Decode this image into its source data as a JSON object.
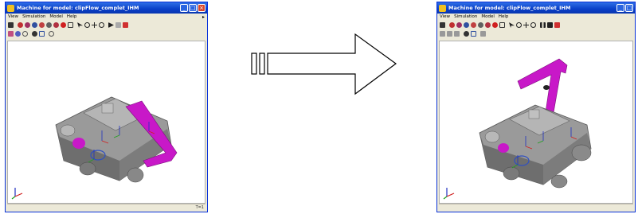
{
  "left_window": {
    "title": "Machine for model: clipFlow_complet_IHM",
    "menus": [
      "View",
      "Simulation",
      "Model",
      "Help"
    ],
    "status_right": "T=1"
  },
  "right_window": {
    "title": "Machine for model: clipFlow_complet_IHM",
    "menus": [
      "View",
      "Simulation",
      "Model",
      "Help"
    ]
  },
  "colors": {
    "part_magenta": "#c818c8",
    "machine_gray": "#8a8a8a",
    "title_blue": "#0a3fc8"
  }
}
